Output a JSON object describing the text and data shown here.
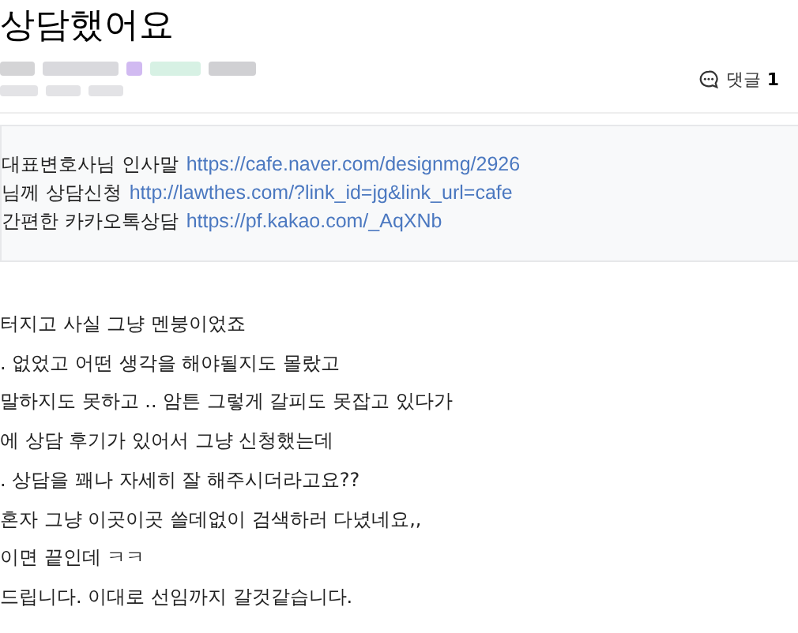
{
  "post": {
    "title": "상담했어요",
    "comments": {
      "label": "댓글",
      "count": "1"
    }
  },
  "links": [
    {
      "label": "대표변호사님 인사말",
      "url": "https://cafe.naver.com/designmg/2926"
    },
    {
      "label": "님께 상담신청",
      "url": "http://lawthes.com/?link_id=jg&link_url=cafe"
    },
    {
      "label": "간편한 카카오톡상담",
      "url": "https://pf.kakao.com/_AqXNb"
    }
  ],
  "body": [
    "터지고 사실 그냥 멘붕이었죠",
    ". 없었고 어떤 생각을 해야될지도 몰랐고",
    "말하지도 못하고 .. 암튼 그렇게 갈피도 못잡고 있다가",
    "에 상담 후기가 있어서 그냥 신청했는데",
    ". 상담을 꽤나 자세히 잘 해주시더라고요??",
    "혼자 그냥 이곳이곳 쓸데없이 검색하러 다녔네요,,",
    "이면 끝인데 ㅋㅋ",
    "드립니다. 이대로 선임까지 갈것같습니다."
  ]
}
